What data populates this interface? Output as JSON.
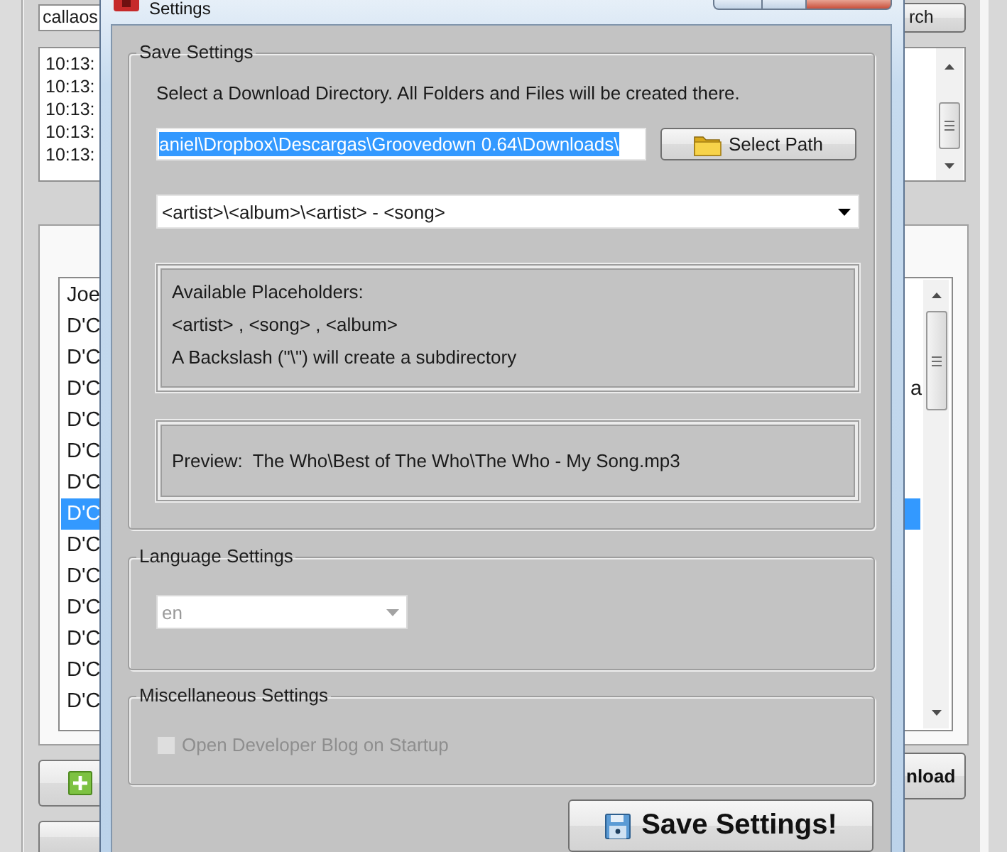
{
  "main_window": {
    "search": {
      "value": "callaos"
    },
    "search_button": {
      "label": "rch"
    },
    "log": {
      "lines": [
        "10:13:",
        "10:13:",
        "10:13:",
        "10:13:",
        "10:13:"
      ]
    },
    "tracks": {
      "rows": [
        {
          "column_1": "Joe",
          "selected": false
        },
        {
          "column_1": "D'C",
          "selected": false
        },
        {
          "column_1": "D'C",
          "selected": false
        },
        {
          "column_1": "D'C",
          "column_2": "a",
          "selected": false
        },
        {
          "column_1": "D'C",
          "selected": false
        },
        {
          "column_1": "D'C",
          "selected": false
        },
        {
          "column_1": "D'C",
          "selected": false
        },
        {
          "column_1": "D'C",
          "selected": true
        },
        {
          "column_1": "D'C",
          "selected": false
        },
        {
          "column_1": "D'C",
          "selected": false
        },
        {
          "column_1": "D'C",
          "selected": false
        },
        {
          "column_1": "D'C",
          "selected": false
        },
        {
          "column_1": "D'C",
          "selected": false
        },
        {
          "column_1": "D'C",
          "selected": false
        }
      ]
    },
    "download_button": {
      "label": "nload"
    }
  },
  "dialog": {
    "title": "Settings",
    "save_settings": {
      "title": "Save Settings",
      "instruction": "Select a Download Directory. All Folders and Files will be created there.",
      "path": {
        "value": "aniel\\Dropbox\\Descargas\\Groovedown 0.64\\Downloads\\",
        "text_selected": true
      },
      "select_path_button": {
        "label": "Select Path"
      },
      "pattern": {
        "value": "<artist>\\<album>\\<artist> - <song>"
      },
      "placeholders": {
        "lines": [
          "Available Placeholders:",
          "<artist> , <song> , <album>",
          "A Backslash (\"\\\") will create a subdirectory"
        ]
      },
      "preview": "Preview:  The Who\\Best of The Who\\The Who - My Song.mp3"
    },
    "language_settings": {
      "title": "Language Settings",
      "language": {
        "value": "en",
        "disabled": true
      }
    },
    "misc_settings": {
      "title": "Miscellaneous Settings",
      "options": [
        {
          "label": "Open Developer Blog on Startup",
          "checked": false,
          "disabled": true
        }
      ]
    },
    "save_button": {
      "label": "Save Settings!"
    }
  }
}
